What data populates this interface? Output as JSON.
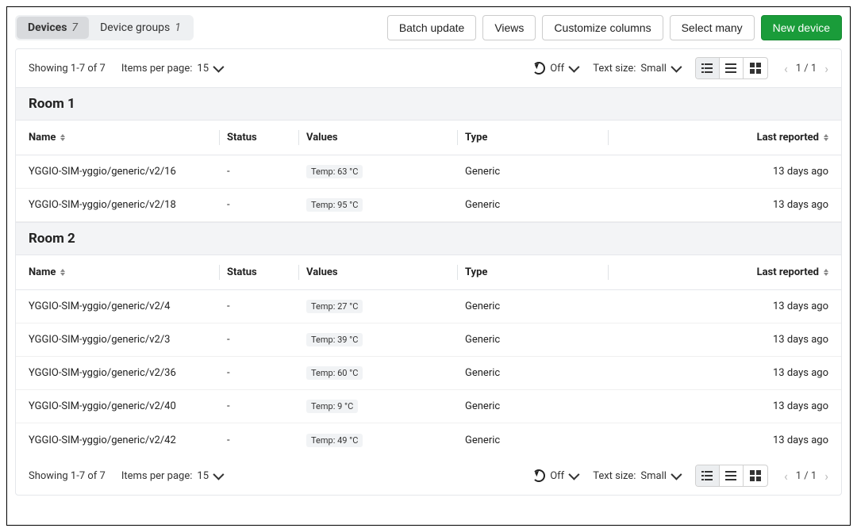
{
  "tabs": {
    "devices": {
      "label": "Devices",
      "count": "7"
    },
    "groups": {
      "label": "Device groups",
      "count": "1"
    }
  },
  "actions": {
    "batch": "Batch update",
    "views": "Views",
    "customize": "Customize columns",
    "selectmany": "Select many",
    "new": "New device"
  },
  "toolbar": {
    "showing": "Showing 1-7 of 7",
    "ipp_label": "Items per page:",
    "ipp_value": "15",
    "refresh_value": "Off",
    "textsize_label": "Text size:",
    "textsize_value": "Small",
    "page": "1 / 1"
  },
  "columns": {
    "name": "Name",
    "status": "Status",
    "values": "Values",
    "type": "Type",
    "last": "Last reported"
  },
  "groups": [
    {
      "title": "Room 1",
      "rows": [
        {
          "name": "YGGIO-SIM-yggio/generic/v2/16",
          "status": "-",
          "value": "Temp: 63 °C",
          "type": "Generic",
          "last": "13 days ago"
        },
        {
          "name": "YGGIO-SIM-yggio/generic/v2/18",
          "status": "-",
          "value": "Temp: 95 °C",
          "type": "Generic",
          "last": "13 days ago"
        }
      ]
    },
    {
      "title": "Room 2",
      "rows": [
        {
          "name": "YGGIO-SIM-yggio/generic/v2/4",
          "status": "-",
          "value": "Temp: 27 °C",
          "type": "Generic",
          "last": "13 days ago"
        },
        {
          "name": "YGGIO-SIM-yggio/generic/v2/3",
          "status": "-",
          "value": "Temp: 39 °C",
          "type": "Generic",
          "last": "13 days ago"
        },
        {
          "name": "YGGIO-SIM-yggio/generic/v2/36",
          "status": "-",
          "value": "Temp: 60 °C",
          "type": "Generic",
          "last": "13 days ago"
        },
        {
          "name": "YGGIO-SIM-yggio/generic/v2/40",
          "status": "-",
          "value": "Temp: 9 °C",
          "type": "Generic",
          "last": "13 days ago"
        },
        {
          "name": "YGGIO-SIM-yggio/generic/v2/42",
          "status": "-",
          "value": "Temp: 49 °C",
          "type": "Generic",
          "last": "13 days ago"
        }
      ]
    }
  ]
}
